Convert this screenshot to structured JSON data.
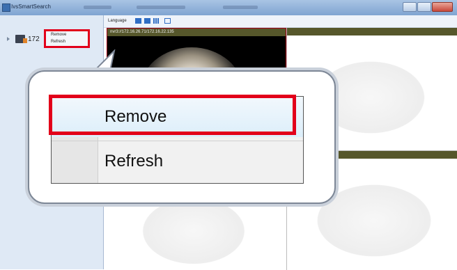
{
  "window": {
    "title": "IvsSmartSearch"
  },
  "tree": {
    "items": [
      {
        "label": "172"
      }
    ]
  },
  "context_menu": {
    "items": [
      {
        "label": "Remove"
      },
      {
        "label": "Refresh"
      }
    ]
  },
  "toolbar": {
    "language_label": "Language",
    "icons": [
      "layout-1x1-icon",
      "layout-2x2-icon",
      "layout-3x3-icon",
      "fullscreen-icon"
    ]
  },
  "video": {
    "active_camera_label": "nvr3://172.16.26.71/172.16.22.135"
  },
  "zoom_callout": {
    "items": [
      {
        "label": "Remove",
        "highlighted": true
      },
      {
        "label": "Refresh"
      }
    ]
  },
  "colors": {
    "highlight_border": "#e2001a",
    "pane_bar": "#56572b",
    "active_pane_border": "#a30016"
  }
}
